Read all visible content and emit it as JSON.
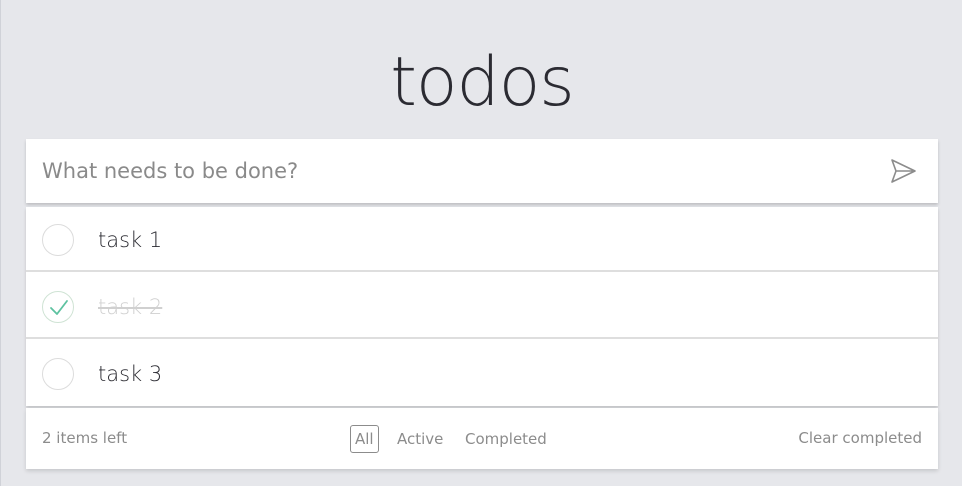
{
  "app": {
    "title": "todos"
  },
  "new_todo": {
    "placeholder": "What needs to be done?",
    "value": ""
  },
  "submit_icon": "send-icon",
  "todos": [
    {
      "label": "task 1",
      "completed": false
    },
    {
      "label": "task 2",
      "completed": true
    },
    {
      "label": "task 3",
      "completed": false
    }
  ],
  "footer": {
    "count_label": "2 items left",
    "filters": [
      {
        "label": "All",
        "selected": true
      },
      {
        "label": "Active",
        "selected": false
      },
      {
        "label": "Completed",
        "selected": false
      }
    ],
    "clear_label": "Clear completed"
  },
  "colors": {
    "background": "#e6e7eb",
    "check": "#5dc2a0",
    "completed_text": "#d0d0d0",
    "muted_text": "#8c8c8c"
  }
}
